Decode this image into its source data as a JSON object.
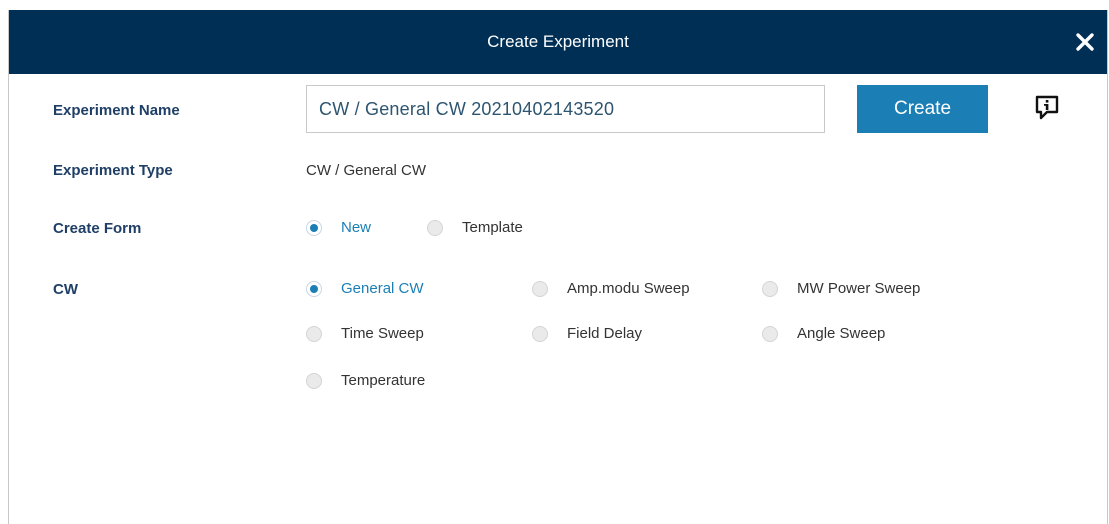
{
  "dialog": {
    "title": "Create Experiment",
    "close_icon": "close-icon"
  },
  "name_row": {
    "label": "Experiment Name",
    "value": "CW / General CW 20210402143520",
    "button": "Create",
    "info_icon": "info-comment-icon"
  },
  "type_row": {
    "label": "Experiment Type",
    "value": "CW / General CW"
  },
  "form_row": {
    "label": "Create Form",
    "options": [
      {
        "label": "New",
        "checked": true
      },
      {
        "label": "Template",
        "checked": false
      }
    ]
  },
  "cw_row": {
    "label": "CW",
    "options": [
      {
        "label": "General CW",
        "checked": true
      },
      {
        "label": "Amp.modu Sweep",
        "checked": false
      },
      {
        "label": "MW Power Sweep",
        "checked": false
      },
      {
        "label": "Time Sweep",
        "checked": false
      },
      {
        "label": "Field Delay",
        "checked": false
      },
      {
        "label": "Angle Sweep",
        "checked": false
      },
      {
        "label": "Temperature",
        "checked": false
      }
    ]
  },
  "colors": {
    "header_bg": "#002f56",
    "accent": "#1b7fb5",
    "label": "#1f3f66"
  }
}
